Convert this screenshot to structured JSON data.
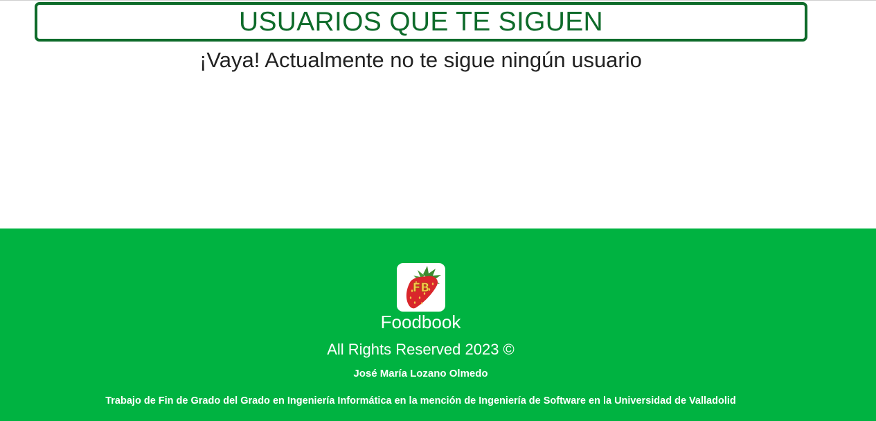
{
  "main": {
    "title": "USUARIOS QUE TE SIGUEN",
    "empty_message": "¡Vaya! Actualmente no te sigue ningún usuario"
  },
  "footer": {
    "logo_icon": "strawberry-logo-icon",
    "logo_text": "FB",
    "brand_name": "Foodbook",
    "rights": "All Rights Reserved 2023 ©",
    "author": "José María Lozano Olmedo",
    "thesis": "Trabajo de Fin de Grado del Grado en Ingeniería Informática en la mención de Ingeniería de Software en la Universidad de Valladolid"
  },
  "colors": {
    "title_green": "#0e6b2a",
    "footer_green": "#00b341",
    "text_dark": "#222222",
    "strawberry_red": "#d9262b",
    "logo_letters": "#f7c84a"
  }
}
